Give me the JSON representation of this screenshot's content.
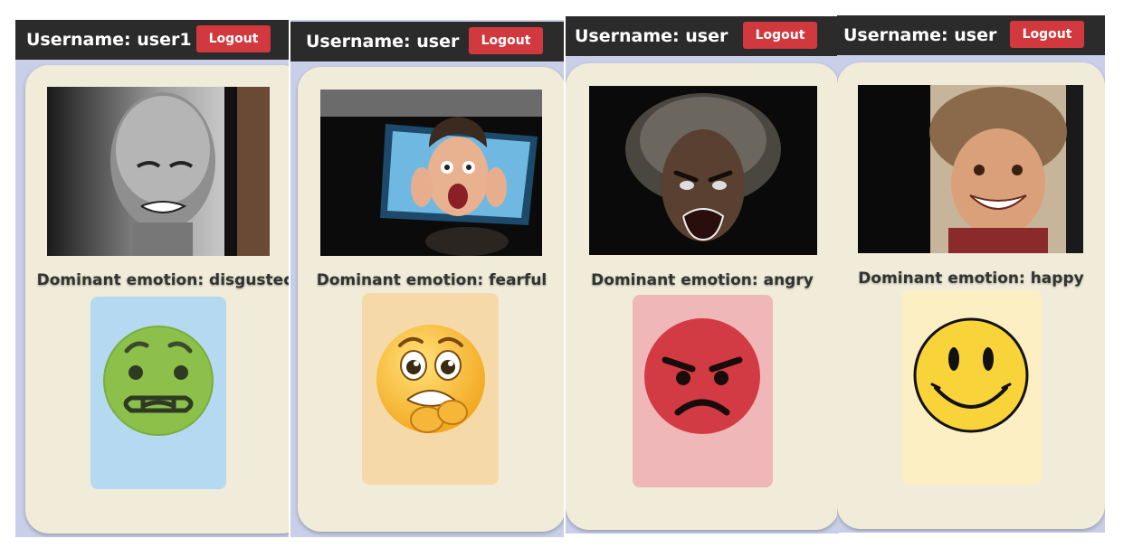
{
  "panels": [
    {
      "username": "Username: user1",
      "logout_label": "Logout",
      "emotion_text": "Dominant emotion: disgusted",
      "emoji": "disgusted-face-icon",
      "emoji_bg": "#b6d9f2"
    },
    {
      "username": "Username: user",
      "logout_label": "Logout",
      "emotion_text": "Dominant emotion: fearful",
      "emoji": "fearful-face-icon",
      "emoji_bg": "#f6d9a8"
    },
    {
      "username": "Username: user",
      "logout_label": "Logout",
      "emotion_text": "Dominant emotion: angry",
      "emoji": "angry-face-icon",
      "emoji_bg": "#efb7b7"
    },
    {
      "username": "Username: user",
      "logout_label": "Logout",
      "emotion_text": "Dominant emotion: happy",
      "emoji": "smiley-face-icon",
      "emoji_bg": "#fbefc3"
    }
  ],
  "colors": {
    "topbar": "#2b2b2b",
    "logout_button": "#d2393f",
    "card": "#f0ecd9",
    "panel_background": "#c9cfe8"
  }
}
